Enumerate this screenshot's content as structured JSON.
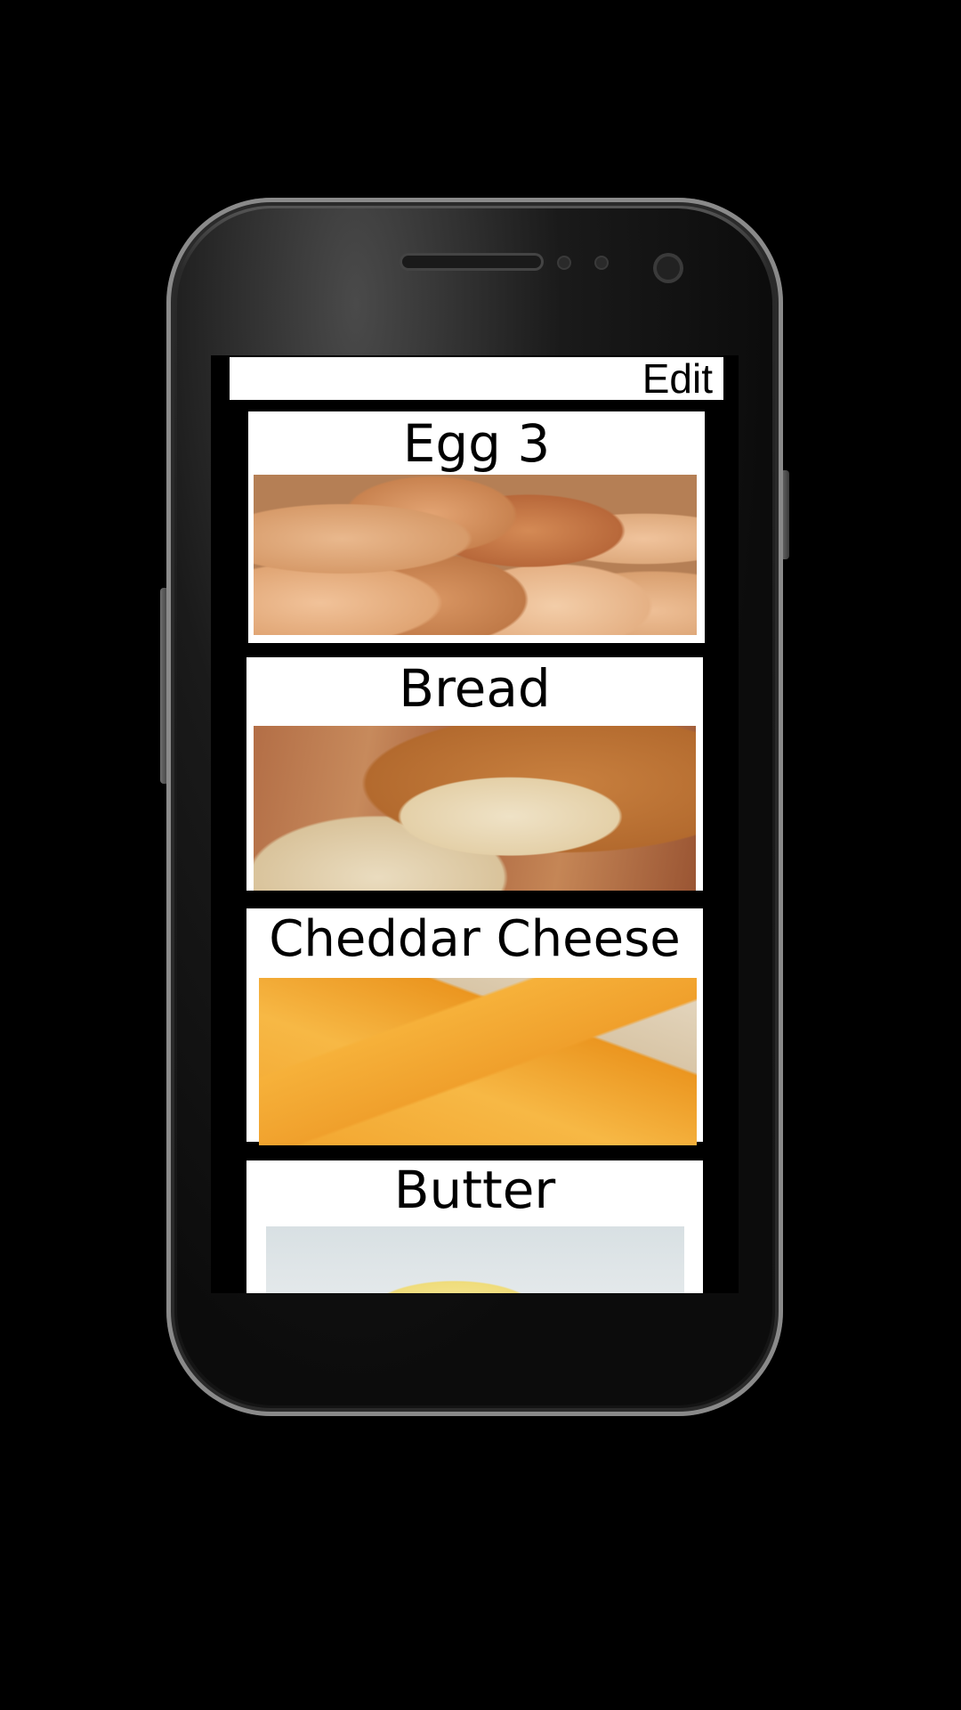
{
  "toolbar": {
    "edit_label": "Edit"
  },
  "items": [
    {
      "title": "Egg 3"
    },
    {
      "title": "Bread"
    },
    {
      "title": "Cheddar Cheese"
    },
    {
      "title": "Butter"
    }
  ]
}
